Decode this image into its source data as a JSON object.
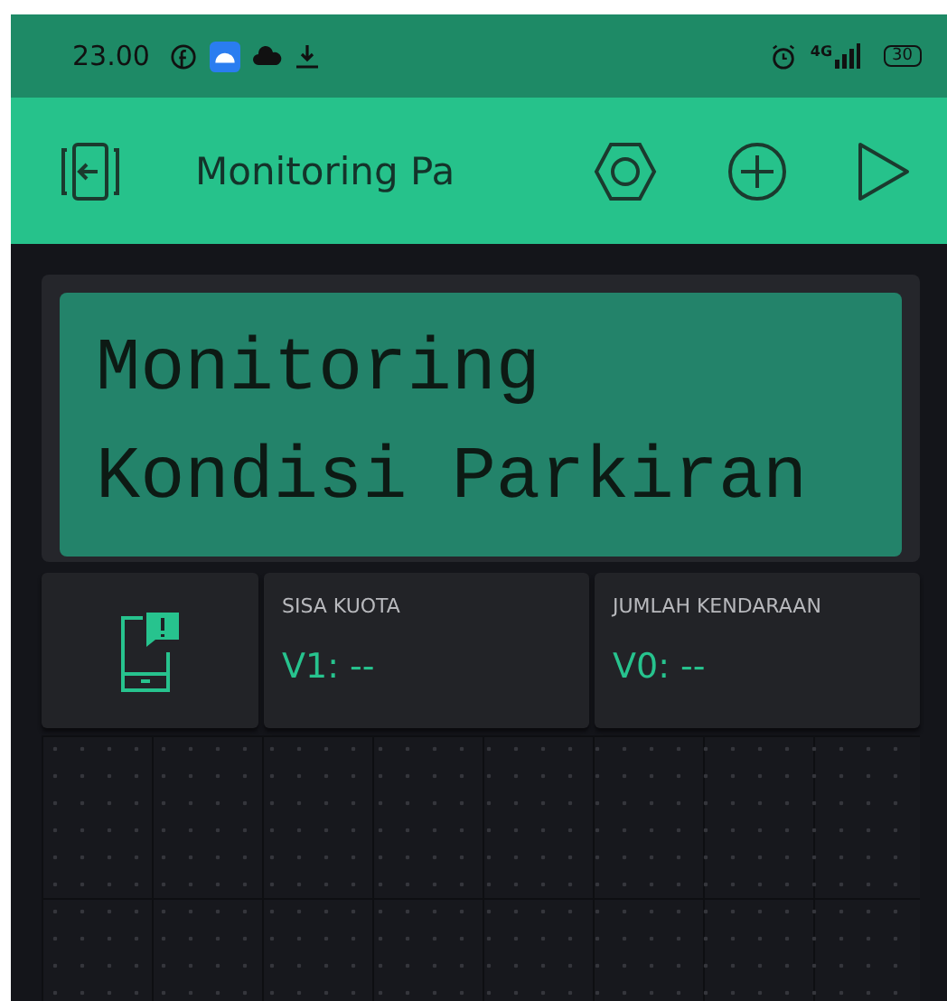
{
  "status_bar": {
    "time": "23.00",
    "network": "4G",
    "battery": "30"
  },
  "app_bar": {
    "title": "Monitoring Pa"
  },
  "widgets": [
    {
      "kind": "lcd",
      "lines": [
        "Monitoring",
        "Kondisi Parkiran"
      ]
    },
    {
      "kind": "notification"
    },
    {
      "kind": "display",
      "label": "SISA KUOTA",
      "value": "V1: --"
    },
    {
      "kind": "display",
      "label": "JUMLAH KENDARAAN",
      "value": "V0: --"
    }
  ]
}
